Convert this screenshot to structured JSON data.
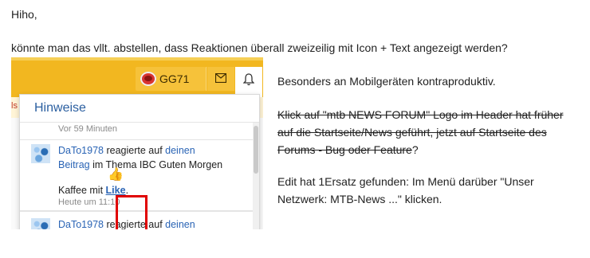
{
  "post": {
    "greeting": "Hiho,",
    "question": "könnte man das vllt. abstellen, dass Reaktionen überall zweizeilig mit Icon + Text angezeigt werden?",
    "right": {
      "line1": "Besonders an Mobilgeräten kontraproduktiv.",
      "strike_line1": "Klick auf \"mtb NEWS FORUM\" Logo im Header hat früher",
      "strike_line2": "auf die Startseite/News geführt, jetzt auf Startseite des",
      "strike_line3": "Forums - Bug oder Feature",
      "strike_suffix": "?",
      "edit_line1": "Edit hat 1Ersatz gefunden: Im Menü darüber \"Unser",
      "edit_line2": "Netzwerk: MTB-News ...\" klicken."
    }
  },
  "screenshot": {
    "navbar": {
      "username": "GG71",
      "accent": "#f2b720"
    },
    "icons": {
      "mail": "envelope-icon",
      "bell": "bell-icon",
      "avatar": "red-logo-avatar",
      "reaction": "thumbs-up"
    },
    "notifications": {
      "title": "Hinweise",
      "previous_time": "Vor 59 Minuten",
      "item": {
        "user": "DaTo1978",
        "action": "reagierte auf",
        "link1": "deinen",
        "link2": "Beitrag",
        "mid": "im Thema IBC Guten Morgen",
        "emoji": "👍",
        "pre_like": "Kaffee mit",
        "like": "Like",
        "suffix": ".",
        "time": "Heute um 11:10"
      },
      "next_item": {
        "user": "DaTo1978",
        "action": "reagierte auf",
        "link1": "deinen"
      }
    },
    "highlight_color": "#e00000"
  }
}
